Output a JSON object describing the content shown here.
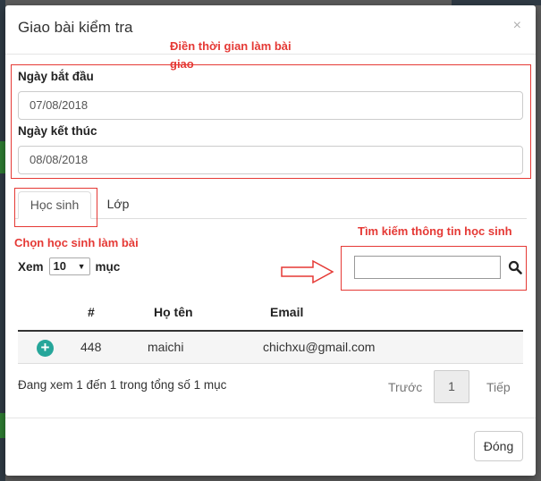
{
  "modal": {
    "title": "Giao bài kiểm tra",
    "close_glyph": "×"
  },
  "annotations": {
    "time_note_line1": "Điền thời gian làm bài",
    "time_note_line2": "giao",
    "choose_students": "Chọn học sinh làm bài",
    "search_note": "Tìm kiếm thông tin học sinh"
  },
  "form": {
    "start_label": "Ngày bắt đầu",
    "start_value": "07/08/2018",
    "end_label": "Ngày kết thúc",
    "end_value": "08/08/2018"
  },
  "tabs": [
    {
      "label": "Học sinh",
      "active": true
    },
    {
      "label": "Lớp",
      "active": false
    }
  ],
  "table_controls": {
    "show_prefix": "Xem",
    "page_size": "10",
    "show_suffix": "mục",
    "search_value": ""
  },
  "table": {
    "columns": [
      "#",
      "Họ tên",
      "Email"
    ],
    "rows": [
      {
        "id": "448",
        "name": "maichi",
        "email": "chichxu@gmail.com"
      }
    ],
    "add_glyph": "+"
  },
  "pagination": {
    "info": "Đang xem 1 đến 1 trong tổng số 1 mục",
    "prev": "Trước",
    "current": "1",
    "next": "Tiếp"
  },
  "footer": {
    "close_label": "Đóng"
  },
  "colors": {
    "annotation": "#e53935",
    "add_button": "#26a69a"
  }
}
